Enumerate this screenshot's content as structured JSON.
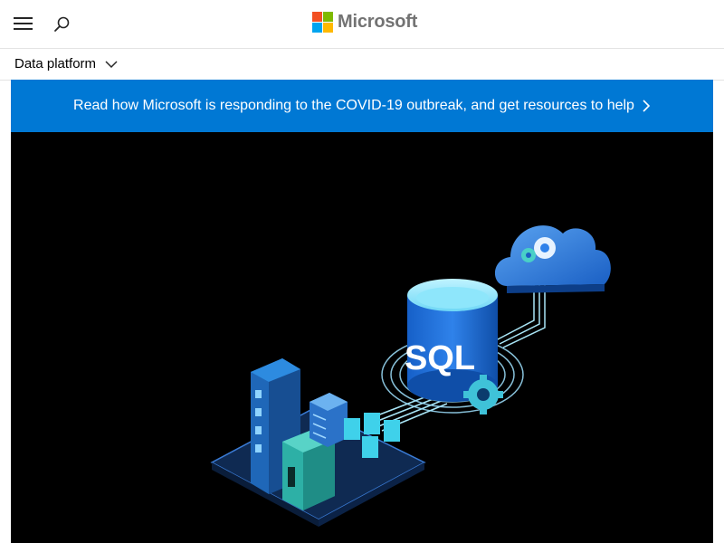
{
  "header": {
    "menu_icon": "hamburger-menu-icon",
    "search_icon": "search-icon",
    "logo": {
      "text": "Microsoft",
      "colors": [
        "#f25022",
        "#7fba00",
        "#00a4ef",
        "#ffb900"
      ]
    }
  },
  "subnav": {
    "label": "Data platform",
    "icon": "chevron-down-icon"
  },
  "banner": {
    "text": "Read how Microsoft is responding to the COVID-19 outbreak, and get resources to help",
    "icon": "chevron-right-icon",
    "color": "#0078d4"
  },
  "hero": {
    "background": "#000000",
    "illustration": {
      "database_label": "SQL"
    }
  }
}
